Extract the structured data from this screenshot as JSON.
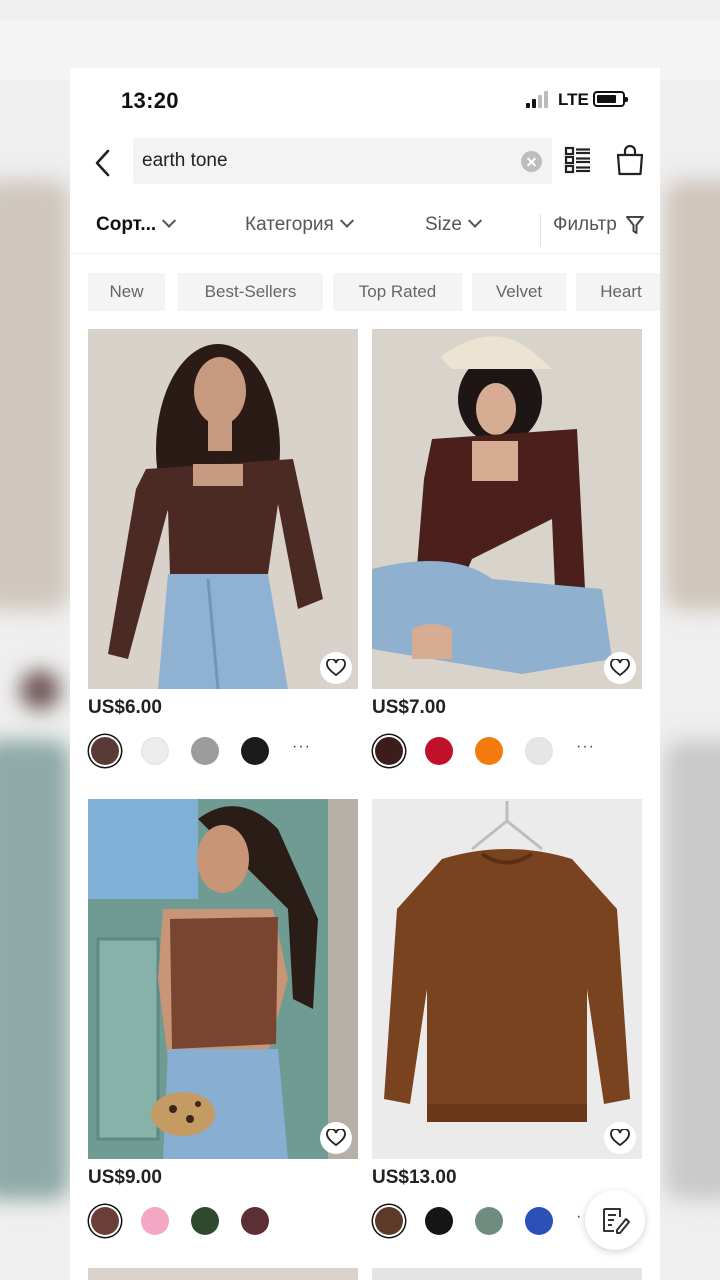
{
  "status_bar": {
    "time": "13:20",
    "network": "LTE"
  },
  "search": {
    "query": "earth tone"
  },
  "filters": {
    "sort": "Сорт...",
    "category": "Категория",
    "size": "Size",
    "filter": "Фильтр"
  },
  "tags": [
    "New",
    "Best-Sellers",
    "Top Rated",
    "Velvet",
    "Heart"
  ],
  "products": [
    {
      "price": "US$6.00",
      "colors": [
        "#5a3a36",
        "#ececec",
        "#9c9c9c",
        "#1b1b1b"
      ],
      "selected": 0,
      "more": "···"
    },
    {
      "price": "US$7.00",
      "colors": [
        "#3d1c1c",
        "#c0102a",
        "#f27a0f",
        "#e6e6e6"
      ],
      "selected": 0,
      "more": "···"
    },
    {
      "price": "US$9.00",
      "colors": [
        "#6b3e37",
        "#f4a7c4",
        "#2e4a2e",
        "#5c2e35"
      ],
      "selected": 0,
      "more": ""
    },
    {
      "price": "US$13.00",
      "colors": [
        "#5b3a26",
        "#151515",
        "#6f8c80",
        "#2d4fb8"
      ],
      "selected": 0,
      "more": "·"
    }
  ],
  "icons": {
    "back": "chevron-left-icon",
    "clear": "clear-x-icon",
    "list_view": "list-view-icon",
    "bag": "shopping-bag-icon",
    "filter": "funnel-icon",
    "wishlist": "heart-icon",
    "feedback": "edit-note-icon"
  }
}
